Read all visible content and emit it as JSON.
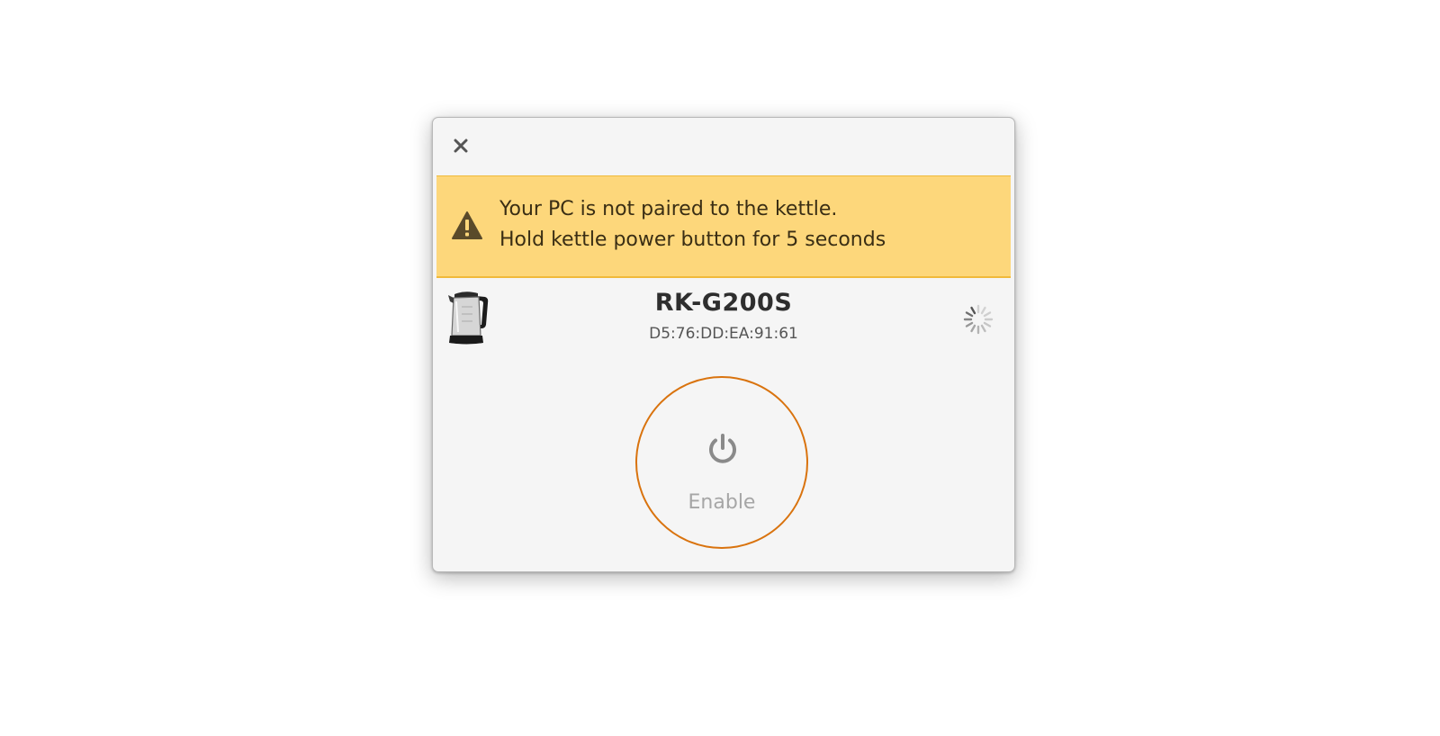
{
  "dialog": {
    "close_icon": "close-icon"
  },
  "infobar": {
    "icon": "warning-icon",
    "line1": "Your PC is not paired to the kettle.",
    "line2": "Hold kettle power button for 5 seconds",
    "background_color": "#fdd77b"
  },
  "device": {
    "image": "kettle-image",
    "name": "RK-G200S",
    "mac": "D5:76:DD:EA:91:61",
    "status_icon": "loading-spinner-icon"
  },
  "power_button": {
    "icon": "power-icon",
    "label": "Enable",
    "ring_color": "#d9730e"
  }
}
